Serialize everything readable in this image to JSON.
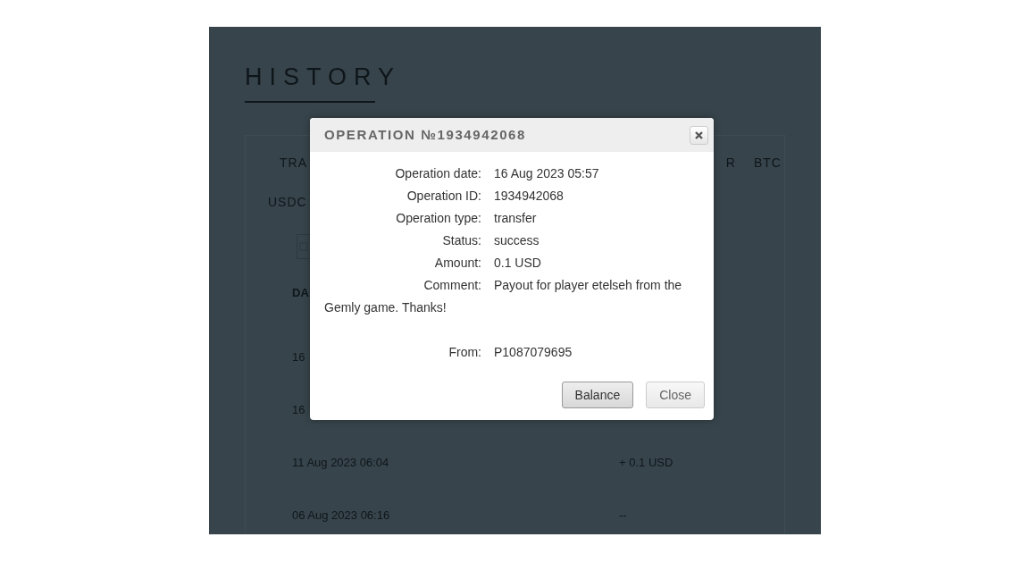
{
  "page": {
    "title": "HISTORY",
    "tabs": [
      {
        "label": "TRA"
      },
      {
        "label": "R"
      },
      {
        "label": "BTC"
      }
    ],
    "subtab": "USDC",
    "table": {
      "column_1": "DA",
      "rows": [
        {
          "date": "16"
        },
        {
          "date": "16"
        },
        {
          "date": "11 Aug 2023 06:04",
          "amount": "+ 0.1 USD"
        },
        {
          "date": "06 Aug 2023 06:16",
          "amount": "--"
        }
      ]
    }
  },
  "dialog": {
    "title": "OPERATION №1934942068",
    "fields": [
      {
        "kind": "line",
        "label": "Operation date:",
        "value": "16 Aug 2023 05:57"
      },
      {
        "kind": "line",
        "label": "Operation ID:",
        "value": "1934942068"
      },
      {
        "kind": "line",
        "label": "Operation type:",
        "value": "transfer"
      },
      {
        "kind": "line",
        "label": "Status:",
        "value": "success"
      },
      {
        "kind": "line",
        "label": "Amount:",
        "value": "0.1 USD"
      },
      {
        "kind": "comment",
        "label": "Comment:",
        "value": "Payout for player etelseh from the Gemly game. Thanks!"
      },
      {
        "kind": "line",
        "label": "From:",
        "value": "P1087079695"
      }
    ],
    "buttons": [
      {
        "label": "Balance",
        "primary": true
      },
      {
        "label": "Close",
        "primary": false
      }
    ]
  }
}
